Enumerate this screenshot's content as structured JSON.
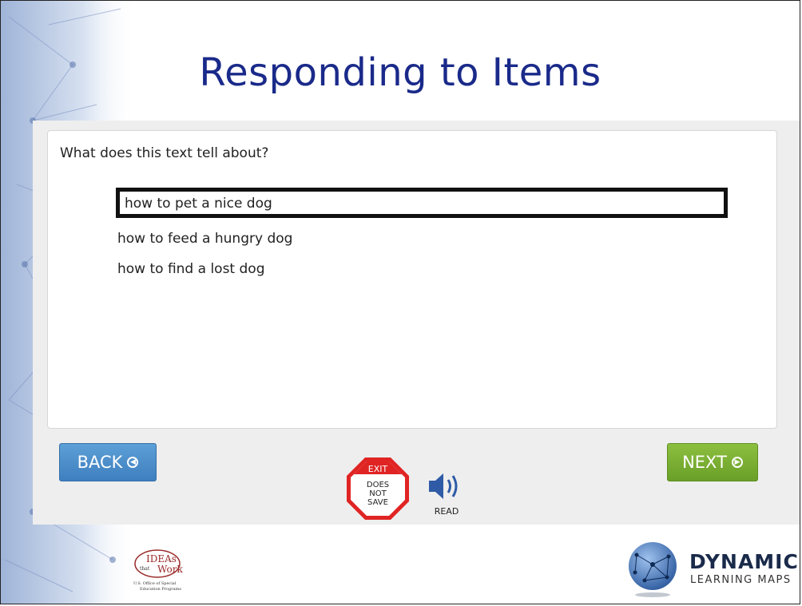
{
  "slide": {
    "title": "Responding to Items"
  },
  "question": {
    "prompt": "What does this text tell about?",
    "options": [
      {
        "label": "how to pet a nice dog",
        "selected": true
      },
      {
        "label": "how to feed a hungry dog",
        "selected": false
      },
      {
        "label": "how to find a lost dog",
        "selected": false
      }
    ]
  },
  "navigation": {
    "back_label": "BACK",
    "next_label": "NEXT",
    "back_color": "#4a8ccb",
    "next_color": "#7aae32"
  },
  "tools": {
    "exit_label": "EXIT",
    "exit_sub": "DOES\nNOT\nSAVE",
    "exit_color": "#e02424",
    "read_label": "READ"
  },
  "footer": {
    "left_logo": {
      "line1": "IDEAs",
      "line2": "that",
      "line3": "Work",
      "caption": "U.S. Office of Special Education Programs"
    },
    "right_logo": {
      "title": "DYNAMIC",
      "subtitle": "LEARNING MAPS"
    }
  }
}
